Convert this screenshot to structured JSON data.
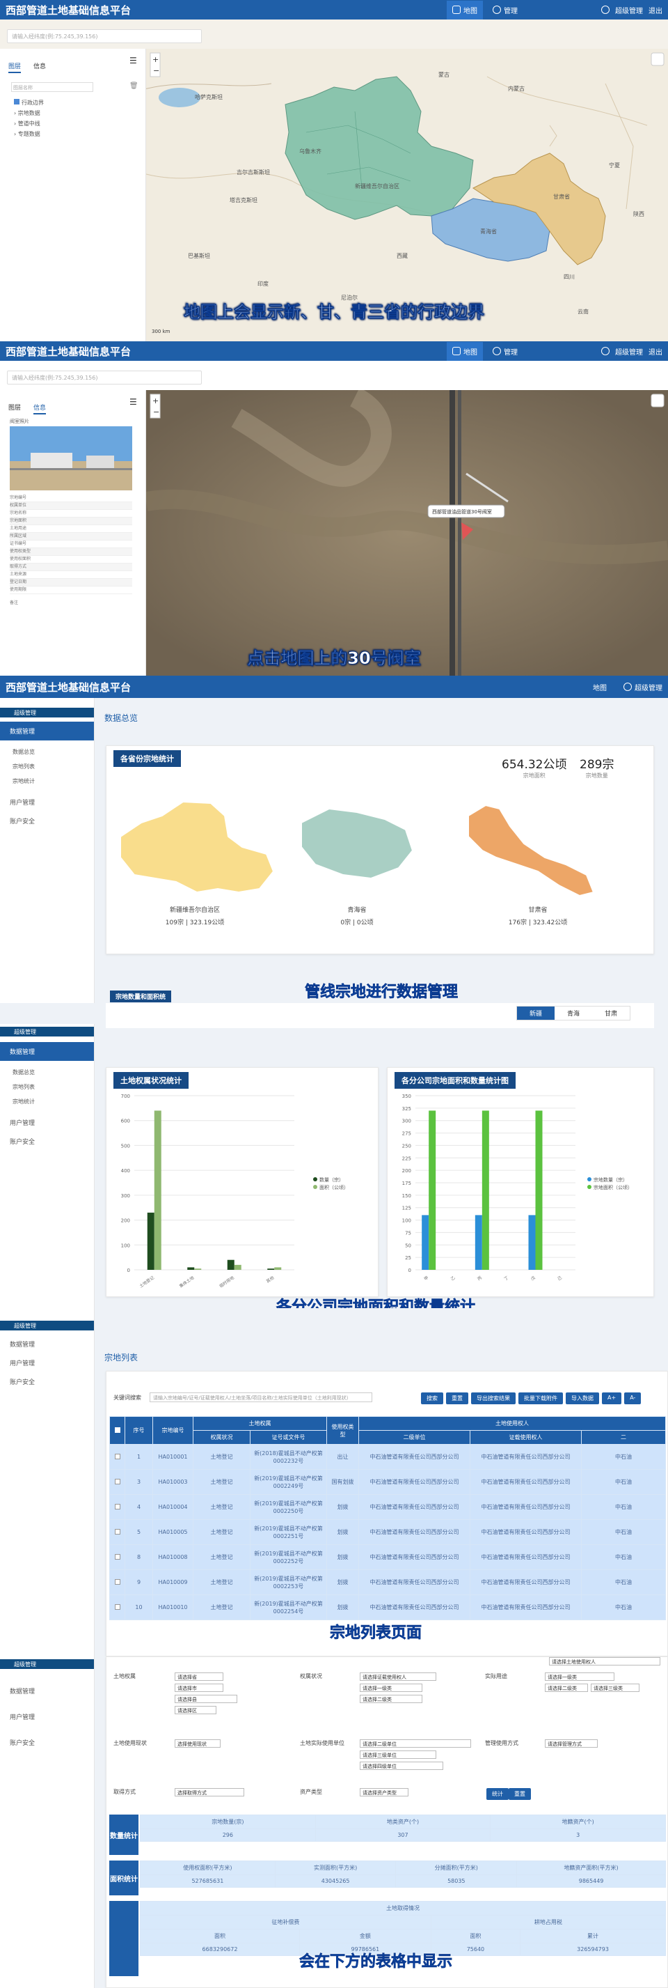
{
  "app": {
    "title": "西部管道土地基础信息平台",
    "nav_map": "地图",
    "nav_manage": "管理",
    "user": "超级管理",
    "logout": "退出"
  },
  "s1": {
    "search_placeholder": "请输入经纬度(例:75.245,39.156)",
    "tabs": [
      "图层",
      "信息"
    ],
    "filter_placeholder": "图层名称",
    "layers": [
      "行政边界",
      "宗地数据",
      "管道中线",
      "专题数据"
    ],
    "map_labels": [
      "哈萨克斯坦",
      "乌鲁木齐",
      "新疆维吾尔自治区",
      "吉尔吉斯斯坦",
      "塔吉克斯坦",
      "青海省",
      "甘肃省",
      "西藏",
      "四川",
      "内蒙古",
      "蒙古",
      "宁夏",
      "陕西",
      "巴基斯坦",
      "印度",
      "尼泊尔",
      "云南"
    ],
    "caption": "地图上会显示新、甘、青三省的行政边界",
    "scale": "300 km"
  },
  "s2": {
    "search_placeholder": "请输入经纬度(例:75.245,39.156)",
    "tabs": [
      "图层",
      "信息"
    ],
    "info_title": "阀室照片",
    "info_rows": [
      "宗地编号",
      "权属单位",
      "宗地名称",
      "宗地面积",
      "土地用途",
      "所属区域",
      "证书编号",
      "使用权类型",
      "使用权面积",
      "取得方式",
      "土地来源",
      "登记日期",
      "使用期限",
      "备注"
    ],
    "popup": "西部管道油品管道30号阀室",
    "caption": "点击地图上的30号阀室"
  },
  "s3": {
    "sidebar_head": "超级管理",
    "sidebar": [
      "数据管理",
      "数据总览",
      "宗地列表",
      "宗地统计",
      "用户管理",
      "账户安全"
    ],
    "page_title": "数据总览",
    "card_title": "各省份宗地统计",
    "area_value": "654.32公顷",
    "area_label": "宗地面积",
    "count_value": "289宗",
    "count_label": "宗地数量",
    "provinces": [
      {
        "name": "新疆维吾尔自治区",
        "stat": "109宗 | 323.19公顷",
        "color": "#f9dd8c"
      },
      {
        "name": "青海省",
        "stat": "0宗 | 0公顷",
        "color": "#a9cfc4"
      },
      {
        "name": "甘肃省",
        "stat": "176宗 | 323.42公顷",
        "color": "#eda667"
      }
    ],
    "caption": "管线宗地进行数据管理",
    "bottom_card": "宗地数量和面积统",
    "bottom_tabs": [
      "新疆",
      "青海",
      "甘肃"
    ]
  },
  "s4": {
    "sidebar_head": "超级管理",
    "sidebar": [
      "数据管理",
      "数据总览",
      "宗地列表",
      "宗地统计",
      "用户管理",
      "账户安全"
    ],
    "card1": "土地权属状况统计",
    "card2": "各分公司宗地面积和数量统计图",
    "caption": "各分公司宗地面积和数量统计"
  },
  "chart_data": [
    {
      "type": "bar",
      "title": "土地权属状况统计",
      "categories": [
        "土地登记",
        "集体土地",
        "临时用地",
        "其他"
      ],
      "series": [
        {
          "name": "数量（宗）",
          "values": [
            230,
            10,
            40,
            5
          ]
        },
        {
          "name": "面积（公顷）",
          "values": [
            640,
            5,
            20,
            10
          ]
        }
      ],
      "ylim": [
        0,
        700
      ],
      "yticks": [
        0,
        100,
        200,
        300,
        400,
        500,
        600,
        700
      ]
    },
    {
      "type": "bar",
      "title": "各分公司宗地面积和数量统计图",
      "categories": [
        "甲",
        "乙",
        "丙",
        "丁",
        "戊",
        "己"
      ],
      "series": [
        {
          "name": "宗地数量（宗）",
          "values": [
            110,
            0,
            110,
            0,
            110,
            0
          ]
        },
        {
          "name": "宗地面积（公顷）",
          "values": [
            320,
            0,
            320,
            0,
            320,
            0
          ]
        }
      ],
      "ylim": [
        0,
        350
      ],
      "yticks": [
        0,
        25,
        50,
        75,
        100,
        125,
        150,
        175,
        200,
        225,
        250,
        275,
        300,
        325,
        350
      ]
    }
  ],
  "s5": {
    "sidebar_head": "超级管理",
    "sidebar": [
      "数据管理",
      "用户管理",
      "账户安全"
    ],
    "page_title": "宗地列表",
    "search_label": "关键词搜索",
    "search_placeholder": "请输入宗地编号/证号/证载使用权人/土地坐落/项目名称/土地实际使用单位（土地利用现状）",
    "buttons": [
      "搜索",
      "重置",
      "导出搜索结果",
      "批量下载附件",
      "导入数据",
      "A+",
      "A-"
    ],
    "headers": [
      "序号",
      "宗地编号",
      "权属状况",
      "证号或文件号",
      "使用权类型",
      "二级单位",
      "证载使用权人",
      "二"
    ],
    "group_headers": [
      "土地权属",
      "土地使用权人"
    ],
    "rows": [
      {
        "no": "1",
        "code": "HA010001",
        "status": "土地登记",
        "doc": "新(2018)霍城县不动产权第0002232号",
        "type": "出让",
        "unit": "中石油管道有限责任公司西部分公司",
        "holder": "中石油管道有限责任公司西部分公司",
        "extra": "中石油"
      },
      {
        "no": "3",
        "code": "HA010003",
        "status": "土地登记",
        "doc": "新(2019)霍城县不动产权第0002249号",
        "type": "国有划拨",
        "unit": "中石油管道有限责任公司西部分公司",
        "holder": "中石油管道有限责任公司西部分公司",
        "extra": "中石油"
      },
      {
        "no": "4",
        "code": "HA010004",
        "status": "土地登记",
        "doc": "新(2019)霍城县不动产权第0002250号",
        "type": "划拨",
        "unit": "中石油管道有限责任公司西部分公司",
        "holder": "中石油管道有限责任公司西部分公司",
        "extra": "中石油"
      },
      {
        "no": "5",
        "code": "HA010005",
        "status": "土地登记",
        "doc": "新(2019)霍城县不动产权第0002251号",
        "type": "划拨",
        "unit": "中石油管道有限责任公司西部分公司",
        "holder": "中石油管道有限责任公司西部分公司",
        "extra": "中石油"
      },
      {
        "no": "8",
        "code": "HA010008",
        "status": "土地登记",
        "doc": "新(2019)霍城县不动产权第0002252号",
        "type": "划拨",
        "unit": "中石油管道有限责任公司西部分公司",
        "holder": "中石油管道有限责任公司西部分公司",
        "extra": "中石油"
      },
      {
        "no": "9",
        "code": "HA010009",
        "status": "土地登记",
        "doc": "新(2019)霍城县不动产权第0002253号",
        "type": "划拨",
        "unit": "中石油管道有限责任公司西部分公司",
        "holder": "中石油管道有限责任公司西部分公司",
        "extra": "中石油"
      },
      {
        "no": "10",
        "code": "HA010010",
        "status": "土地登记",
        "doc": "新(2019)霍城县不动产权第0002254号",
        "type": "划拨",
        "unit": "中石油管道有限责任公司西部分公司",
        "holder": "中石油管道有限责任公司西部分公司",
        "extra": "中石油"
      }
    ],
    "caption": "宗地列表页面"
  },
  "s6": {
    "sidebar_head": "超级管理",
    "sidebar": [
      "数据管理",
      "用户管理",
      "账户安全"
    ],
    "form_labels": [
      "土地权属",
      "权属状况",
      "实际用途",
      "土地使用现状",
      "土地实际使用单位",
      "管理使用方式",
      "取得方式",
      "资产类型"
    ],
    "selects": [
      "请选择省",
      "请选择市",
      "请选择县",
      "请选择区",
      "请选择证载使用权人",
      "请选择一级类",
      "请选择二级类",
      "请选择一级类",
      "请选择二级类",
      "请选择三级类",
      "选择使用现状",
      "请选择二级单位",
      "请选择三级单位",
      "请选择四级单位",
      "请选择管理方式",
      "选择取得方式",
      "请选择资产类型",
      "请选择土地使用权人"
    ],
    "stat_btns": [
      "统计",
      "重置"
    ],
    "count_label": "数量统计",
    "count_headers": [
      "宗地数量(宗)",
      "地类资产(个)",
      "地籍资产(个)"
    ],
    "count_values": [
      "296",
      "307",
      "3"
    ],
    "area_label": "面积统计",
    "area_headers": [
      "使用权面积(平方米)",
      "实测面积(平方米)",
      "分摊面积(平方米)",
      "地籍资产面积(平方米)"
    ],
    "area_values": [
      "527685631",
      "43045265",
      "58035",
      "9865449"
    ],
    "land_label": "土地取得情况",
    "land_headers": [
      "征地补偿费",
      "耕地占用税",
      "耕地开垦费"
    ],
    "land_sub": [
      "面积",
      "金额",
      "面积",
      "累计"
    ],
    "land_values": [
      "6683290672",
      "99786561",
      "75640",
      "326594793"
    ],
    "caption": "会在下方的表格中显示"
  }
}
